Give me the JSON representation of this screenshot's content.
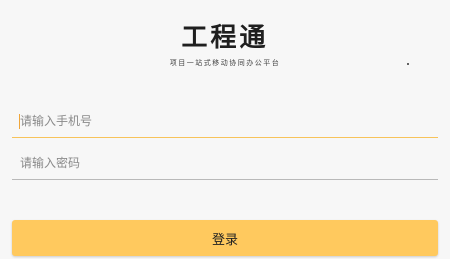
{
  "brand": {
    "title": "工程通",
    "subtitle": "项目一站式移动协同办公平台"
  },
  "form": {
    "phone": {
      "placeholder": "请输入手机号",
      "value": ""
    },
    "password": {
      "placeholder": "请输入密码",
      "value": ""
    },
    "submit_label": "登录"
  },
  "colors": {
    "accent": "#ffc95e",
    "active_underline": "#f7c35a",
    "underline": "#b9b9b9",
    "background": "#f7f7f7"
  }
}
